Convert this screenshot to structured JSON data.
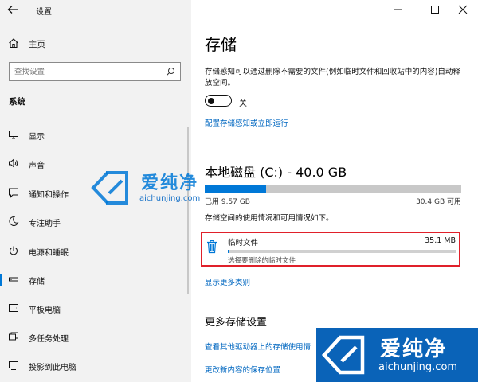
{
  "sidebar": {
    "app_title": "设置",
    "home_label": "主页",
    "search_placeholder": "查找设置",
    "section_label": "系统",
    "items": [
      {
        "label": "显示",
        "icon": "monitor-icon"
      },
      {
        "label": "声音",
        "icon": "speaker-icon"
      },
      {
        "label": "通知和操作",
        "icon": "notification-icon"
      },
      {
        "label": "专注助手",
        "icon": "moon-icon"
      },
      {
        "label": "电源和睡眠",
        "icon": "power-icon"
      },
      {
        "label": "存储",
        "icon": "storage-icon",
        "active": true
      },
      {
        "label": "平板电脑",
        "icon": "tablet-icon"
      },
      {
        "label": "多任务处理",
        "icon": "multitask-icon"
      },
      {
        "label": "投影到此电脑",
        "icon": "project-icon"
      }
    ]
  },
  "window": {
    "controls": [
      "minimize",
      "maximize",
      "close"
    ]
  },
  "main": {
    "title": "存储",
    "sense_description": "存储感知可以通过删除不需要的文件(例如临时文件和回收站中的内容)自动释放空间。",
    "toggle_state": "off",
    "toggle_label": "关",
    "configure_link": "配置存储感知或立即运行",
    "disk": {
      "title": "本地磁盘 (C:) - 40.0 GB",
      "used_label": "已用 9.57 GB",
      "free_label": "30.4 GB 可用",
      "used_fraction": 0.239
    },
    "usage_description": "存储空间的使用情况和可用情况如下。",
    "temp": {
      "name": "临时文件",
      "size": "35.1 MB",
      "subtitle": "选择要删除的临时文件",
      "fraction": 0.003
    },
    "show_more_link": "显示更多类别",
    "more_settings_title": "更多存储设置",
    "other_drives_link": "查看其他驱动器上的存储使用情",
    "change_location_link": "更改新内容的保存位置"
  },
  "watermark": {
    "brand": "爱纯净",
    "site": "aichunjing.com"
  },
  "colors": {
    "accent": "#0078d7",
    "link": "#0067c0",
    "highlight_border": "#e0202a",
    "sidebar_bg": "#f2f2f2",
    "watermark_bg": "#0a63b8"
  }
}
